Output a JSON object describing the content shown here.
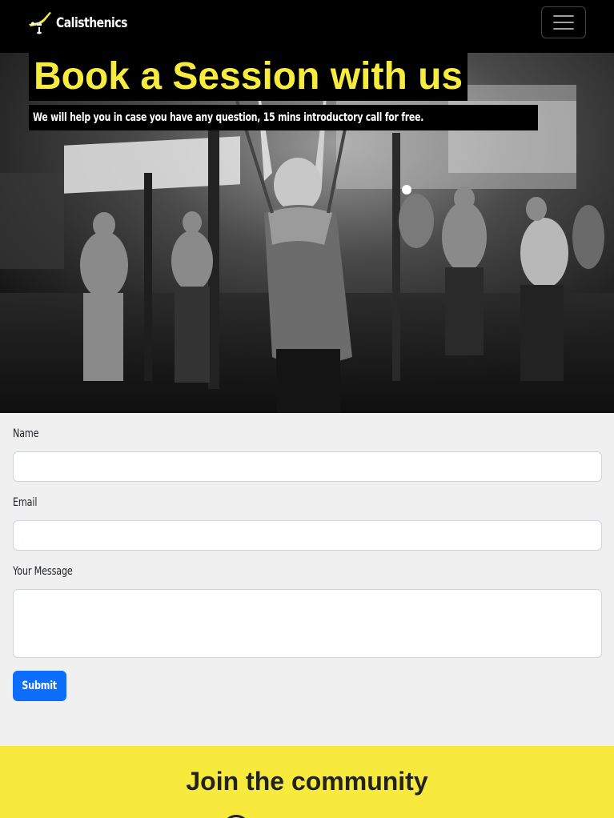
{
  "navbar": {
    "brand_name": "Calisthenics",
    "logo_icon": "calisthenics-athlete-logo",
    "menu_icon": "hamburger-icon"
  },
  "hero": {
    "title": "Book a Session with us",
    "subtitle": "We will help you in case you have any question, 15 mins introductory call for free."
  },
  "form": {
    "name_label": "Name",
    "name_value": "",
    "email_label": "Email",
    "email_value": "",
    "message_label": "Your Message",
    "message_value": "",
    "submit_label": "Submit"
  },
  "community": {
    "title": "Join the community",
    "icon": "social-icon"
  },
  "colors": {
    "accent_yellow": "#f8ea3c",
    "title_yellow": "#f7ec3e",
    "primary_blue": "#0d6efd",
    "navbar_bg": "#000000"
  }
}
